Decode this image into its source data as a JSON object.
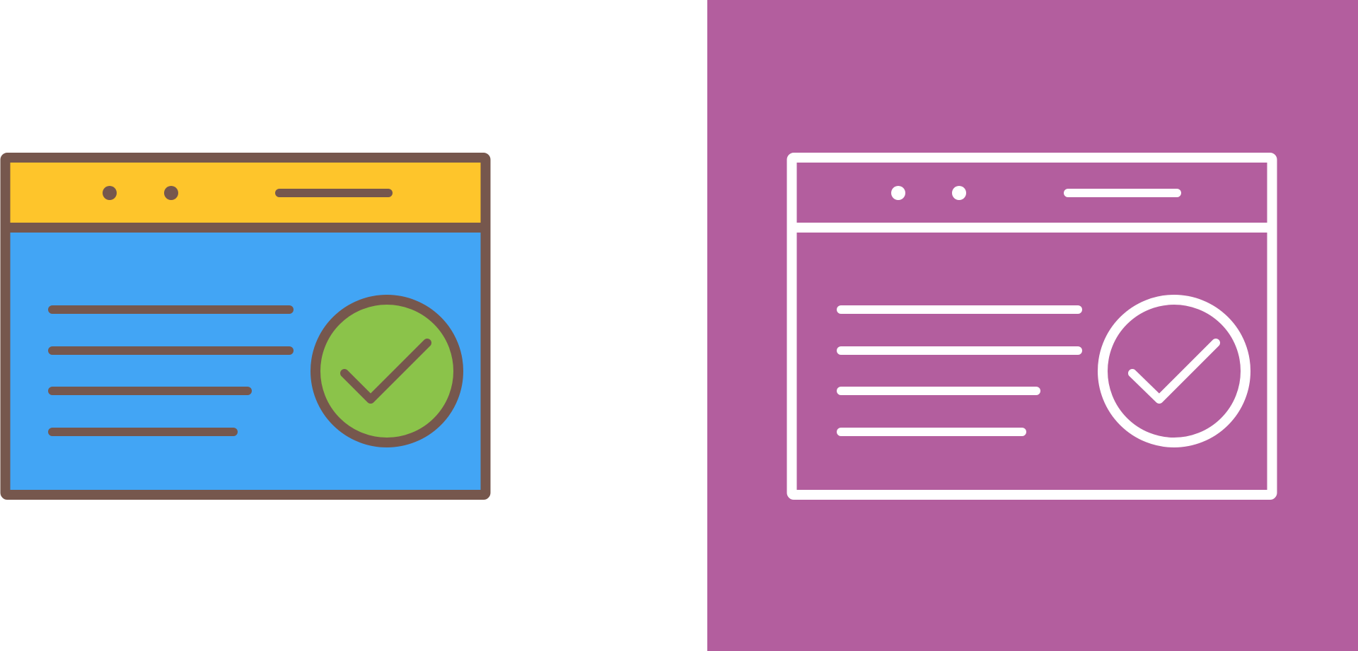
{
  "colors": {
    "page_background": "#ffffff",
    "right_panel_background": "#b35e9e",
    "outline_brown": "#76574d",
    "titlebar_yellow": "#fec52b",
    "content_blue": "#42a5f5",
    "check_green": "#8bc34a",
    "outline_white": "#ffffff"
  },
  "icons": {
    "left": "browser-window-checkmark-color-icon",
    "right": "browser-window-checkmark-line-icon"
  }
}
